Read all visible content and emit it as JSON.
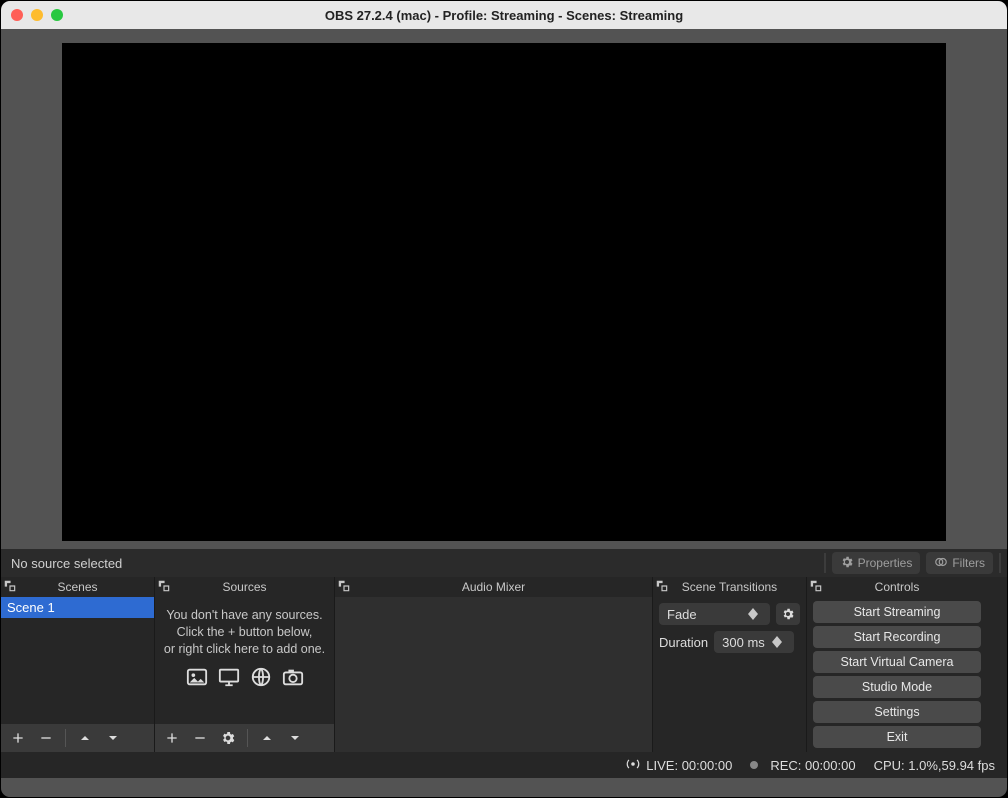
{
  "window": {
    "title": "OBS 27.2.4 (mac) - Profile: Streaming - Scenes: Streaming"
  },
  "source_toolbar": {
    "no_source": "No source selected",
    "properties": "Properties",
    "filters": "Filters"
  },
  "docks": {
    "scenes": {
      "title": "Scenes",
      "items": [
        "Scene 1"
      ]
    },
    "sources": {
      "title": "Sources",
      "empty_line1": "You don't have any sources.",
      "empty_line2": "Click the + button below,",
      "empty_line3": "or right click here to add one."
    },
    "audio_mixer": {
      "title": "Audio Mixer"
    },
    "scene_transitions": {
      "title": "Scene Transitions",
      "selected": "Fade",
      "duration_label": "Duration",
      "duration_value": "300 ms"
    },
    "controls": {
      "title": "Controls",
      "buttons": {
        "start_streaming": "Start Streaming",
        "start_recording": "Start Recording",
        "start_virtual_camera": "Start Virtual Camera",
        "studio_mode": "Studio Mode",
        "settings": "Settings",
        "exit": "Exit"
      }
    }
  },
  "status": {
    "live": "LIVE: 00:00:00",
    "rec": "REC: 00:00:00",
    "cpu": "CPU: 1.0%,59.94 fps"
  }
}
